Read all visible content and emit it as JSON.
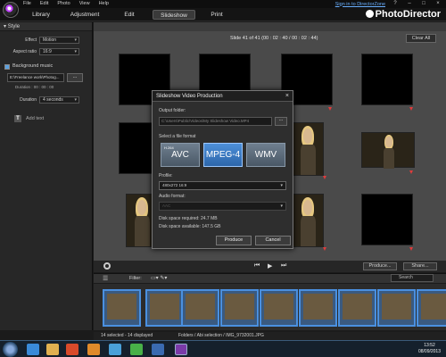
{
  "menubar": {
    "items": [
      "File",
      "Edit",
      "Photo",
      "View",
      "Help"
    ],
    "signin": "Sign in to DirectorZone",
    "win_controls": [
      "?",
      "–",
      "□",
      "×"
    ]
  },
  "tabs": [
    "Library",
    "Adjustment",
    "Edit",
    "Slideshow",
    "Print"
  ],
  "active_tab": "Slideshow",
  "brand": "PhotoDirector",
  "left_panel": {
    "section": "Style",
    "effect_label": "Effect",
    "effect_value": "Motion",
    "aspect_label": "Aspect ratio",
    "aspect_value": "16:9",
    "bg_music_label": "Background music",
    "bg_music_file": "E:\\Freelance work\\Photog...",
    "bg_music_more": "...",
    "music_duration": "Duration : 00 : 00 : 00",
    "duration_label": "Duration",
    "duration_value": "4 seconds",
    "add_text": "Add text",
    "add_text_icon": "T"
  },
  "main": {
    "slide_info": "Slide  41 of  41 (00 : 02 : 40 / 00 : 02 : 44)",
    "clear_all": "Clear All",
    "produce": "Produce...",
    "share": "Share..."
  },
  "filmstrip": {
    "filter_label": "Filter:",
    "search_placeholder": "Search"
  },
  "status": {
    "left": "14 selected - 14 displayed",
    "mid": "Folders / Abi selection / IMG_9732001.JPG"
  },
  "clock": {
    "time": "13:52",
    "date": "08/09/2013"
  },
  "dialog": {
    "title": "Slideshow Video Production",
    "close": "×",
    "output_folder_label": "Output folder:",
    "output_folder": "C:\\Users\\Public\\Videos\\My Slideshow Video.MP4",
    "output_more": "...",
    "file_format_label": "Select a file format",
    "formats": [
      {
        "label": "AVC",
        "small": "H.264"
      },
      {
        "label": "MPEG-4",
        "small": ""
      },
      {
        "label": "WMV",
        "small": ""
      }
    ],
    "selected_format": "MPEG-4",
    "profile_label": "Profile:",
    "profile_value": "480x272 16:9",
    "audio_label": "Audio format:",
    "audio_value": "AAC",
    "disk_required": "Disk space required: 24.7 MB",
    "disk_available": "Disk space available: 147.5 GB",
    "produce": "Produce",
    "cancel": "Cancel"
  }
}
